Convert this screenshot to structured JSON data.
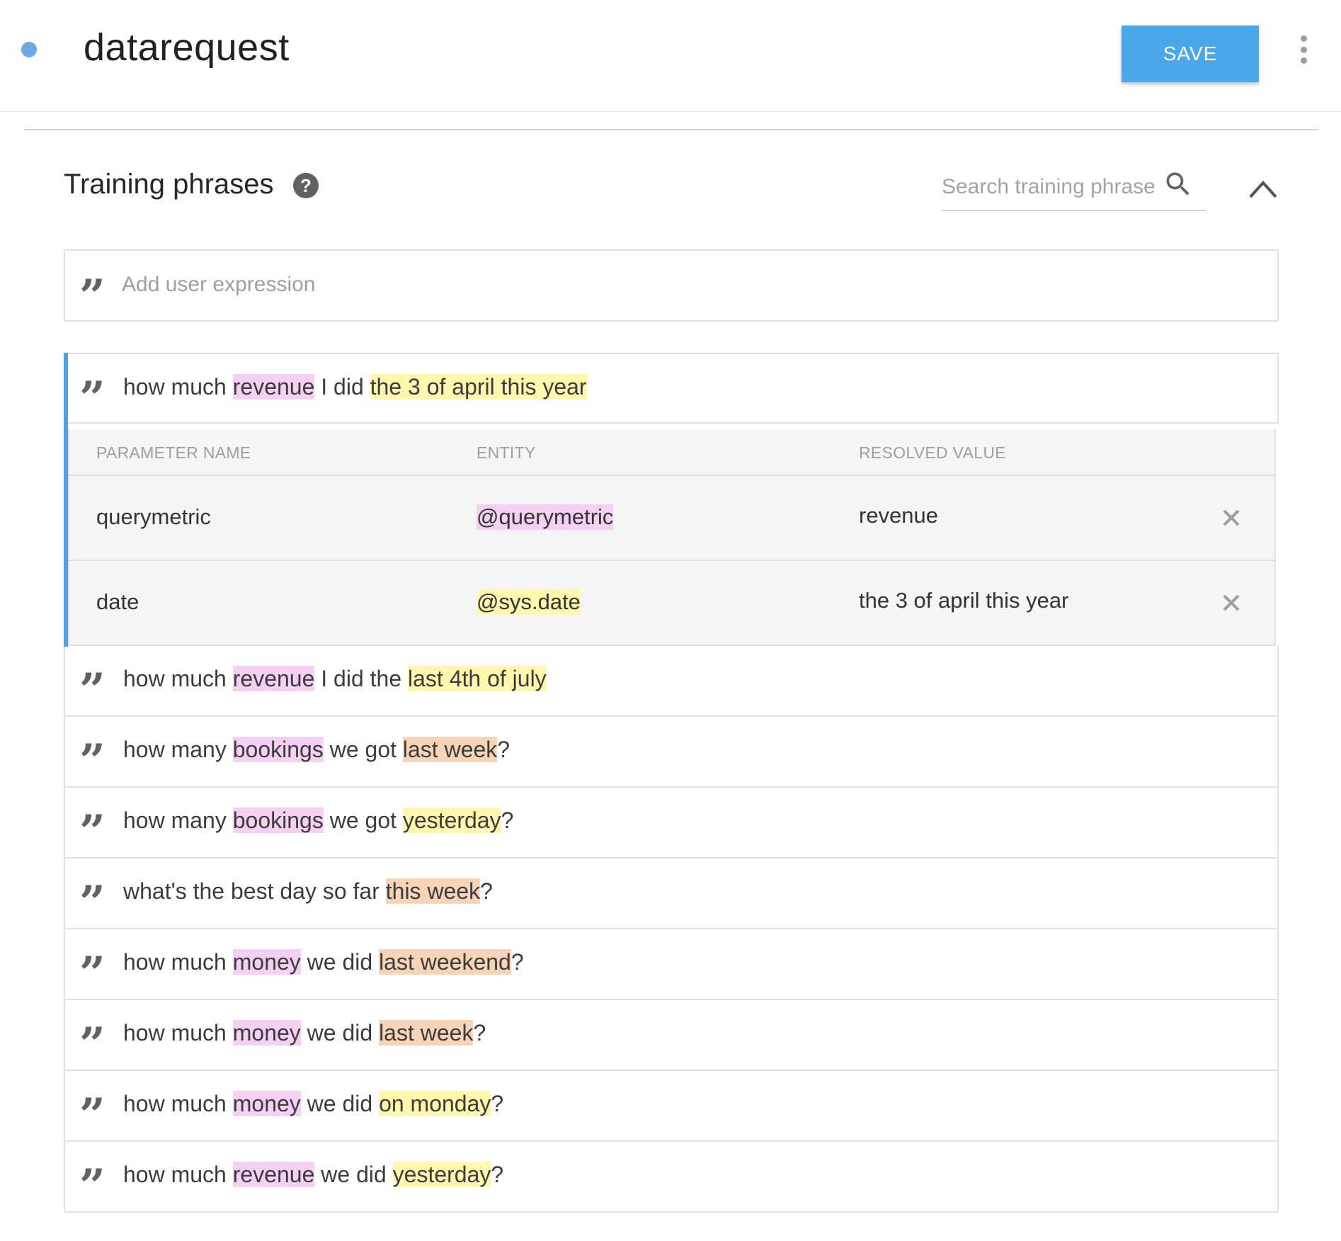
{
  "header": {
    "intent_name": "datarequest",
    "save_label": "SAVE"
  },
  "section": {
    "title": "Training phrases",
    "search_placeholder": "Search training phrases",
    "add_placeholder": "Add user expression"
  },
  "colors": {
    "accent": "#4aa8ea",
    "selection_bar": "#4aa3e6",
    "highlight_pink": "#f6d0f2",
    "highlight_yellow": "#fff7ad",
    "highlight_orange": "#f7d3b8"
  },
  "phrases": [
    {
      "parts": [
        {
          "t": "how much "
        },
        {
          "t": "revenue",
          "h": "pink"
        },
        {
          "t": " I did "
        },
        {
          "t": "the 3 of april this year",
          "h": "yellow"
        }
      ]
    },
    {
      "parts": [
        {
          "t": "how much "
        },
        {
          "t": "revenue",
          "h": "pink"
        },
        {
          "t": " I did the "
        },
        {
          "t": "last 4th of july",
          "h": "yellow"
        }
      ]
    },
    {
      "parts": [
        {
          "t": "how many "
        },
        {
          "t": "bookings",
          "h": "pink"
        },
        {
          "t": " we got "
        },
        {
          "t": "last week",
          "h": "orange"
        },
        {
          "t": "?"
        }
      ]
    },
    {
      "parts": [
        {
          "t": "how many "
        },
        {
          "t": "bookings",
          "h": "pink"
        },
        {
          "t": " we got "
        },
        {
          "t": "yesterday",
          "h": "yellow"
        },
        {
          "t": "?"
        }
      ]
    },
    {
      "parts": [
        {
          "t": "what's the best day so far "
        },
        {
          "t": "this week",
          "h": "orange"
        },
        {
          "t": "?"
        }
      ]
    },
    {
      "parts": [
        {
          "t": "how much "
        },
        {
          "t": "money",
          "h": "pink"
        },
        {
          "t": " we did "
        },
        {
          "t": "last weekend",
          "h": "orange"
        },
        {
          "t": "?"
        }
      ]
    },
    {
      "parts": [
        {
          "t": "how much "
        },
        {
          "t": "money",
          "h": "pink"
        },
        {
          "t": " we did "
        },
        {
          "t": "last week",
          "h": "orange"
        },
        {
          "t": "?"
        }
      ]
    },
    {
      "parts": [
        {
          "t": "how much "
        },
        {
          "t": "money",
          "h": "pink"
        },
        {
          "t": " we did "
        },
        {
          "t": "on monday",
          "h": "yellow"
        },
        {
          "t": "?"
        }
      ]
    },
    {
      "parts": [
        {
          "t": "how much "
        },
        {
          "t": "revenue",
          "h": "pink"
        },
        {
          "t": " we did "
        },
        {
          "t": "yesterday",
          "h": "yellow"
        },
        {
          "t": "?"
        }
      ]
    }
  ],
  "param_table": {
    "headers": [
      "PARAMETER NAME",
      "ENTITY",
      "RESOLVED VALUE"
    ],
    "rows": [
      {
        "name": "querymetric",
        "entity": "@querymetric",
        "entity_h": "pink",
        "value": "revenue"
      },
      {
        "name": "date",
        "entity": "@sys.date",
        "entity_h": "yellow",
        "value": "the 3 of april this year"
      }
    ]
  },
  "icons": {
    "more": "more-vert-icon",
    "help": "help-icon",
    "search": "search-icon",
    "collapse": "chevron-up-icon",
    "quote": "quote-icon",
    "remove": "close-icon"
  }
}
